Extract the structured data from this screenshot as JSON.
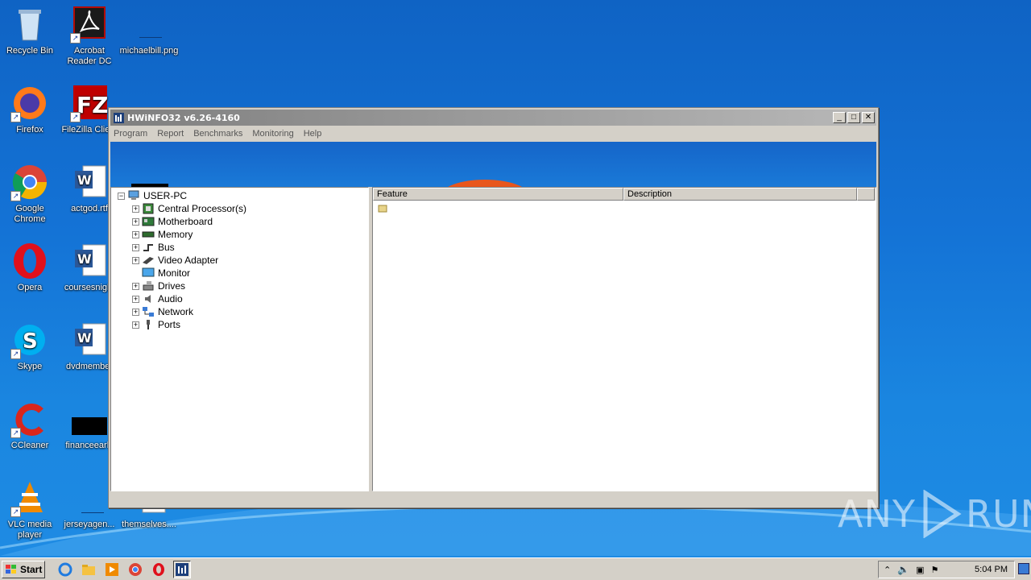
{
  "desktop": {
    "icons": [
      {
        "label": "Recycle Bin",
        "icon": "recycle-bin-icon"
      },
      {
        "label": "Acrobat Reader DC",
        "icon": "acrobat-icon"
      },
      {
        "label": "michaelbill.png",
        "icon": "image-file-icon"
      },
      {
        "label": "Firefox",
        "icon": "firefox-icon"
      },
      {
        "label": "FileZilla Client",
        "icon": "filezilla-icon"
      },
      {
        "label": "Google Chrome",
        "icon": "chrome-icon"
      },
      {
        "label": "actgod.rtf",
        "icon": "word-doc-icon"
      },
      {
        "label": "Opera",
        "icon": "opera-icon"
      },
      {
        "label": "coursesnight",
        "icon": "word-doc-icon"
      },
      {
        "label": "Skype",
        "icon": "skype-icon"
      },
      {
        "label": "dvdmember",
        "icon": "word-doc-icon"
      },
      {
        "label": "CCleaner",
        "icon": "ccleaner-icon"
      },
      {
        "label": "financeearly",
        "icon": "image-file-icon"
      },
      {
        "label": "VLC media player",
        "icon": "vlc-icon"
      },
      {
        "label": "jerseyagen...",
        "icon": "image-file-icon"
      },
      {
        "label": "themselves....",
        "icon": "word-doc-icon"
      }
    ]
  },
  "window": {
    "title": "HWiNFO32 v6.26-4160",
    "buttons": {
      "minimize": "_",
      "maximize": "□",
      "close": "✕"
    },
    "menu": [
      "Program",
      "Report",
      "Benchmarks",
      "Monitoring",
      "Help"
    ],
    "tree": {
      "root": "USER-PC",
      "items": [
        {
          "label": "Central Processor(s)",
          "icon": "cpu-icon",
          "expandable": true
        },
        {
          "label": "Motherboard",
          "icon": "motherboard-icon",
          "expandable": true
        },
        {
          "label": "Memory",
          "icon": "memory-icon",
          "expandable": true
        },
        {
          "label": "Bus",
          "icon": "bus-icon",
          "expandable": true
        },
        {
          "label": "Video Adapter",
          "icon": "video-adapter-icon",
          "expandable": true
        },
        {
          "label": "Monitor",
          "icon": "monitor-icon",
          "expandable": false
        },
        {
          "label": "Drives",
          "icon": "drives-icon",
          "expandable": true
        },
        {
          "label": "Audio",
          "icon": "audio-icon",
          "expandable": true
        },
        {
          "label": "Network",
          "icon": "network-icon",
          "expandable": true
        },
        {
          "label": "Ports",
          "icon": "ports-icon",
          "expandable": true
        }
      ]
    },
    "list": {
      "columns": [
        "Feature",
        "Description"
      ]
    }
  },
  "taskbar": {
    "start_label": "Start",
    "quicklaunch": [
      "ie-icon",
      "explorer-icon",
      "media-player-icon",
      "chrome-icon",
      "opera-icon",
      "hwinfo-icon"
    ],
    "clock": "5:04 PM"
  },
  "watermark": "ANY RUN",
  "colors": {
    "desktop": "#1473d6",
    "window": "#d4d0c8"
  }
}
